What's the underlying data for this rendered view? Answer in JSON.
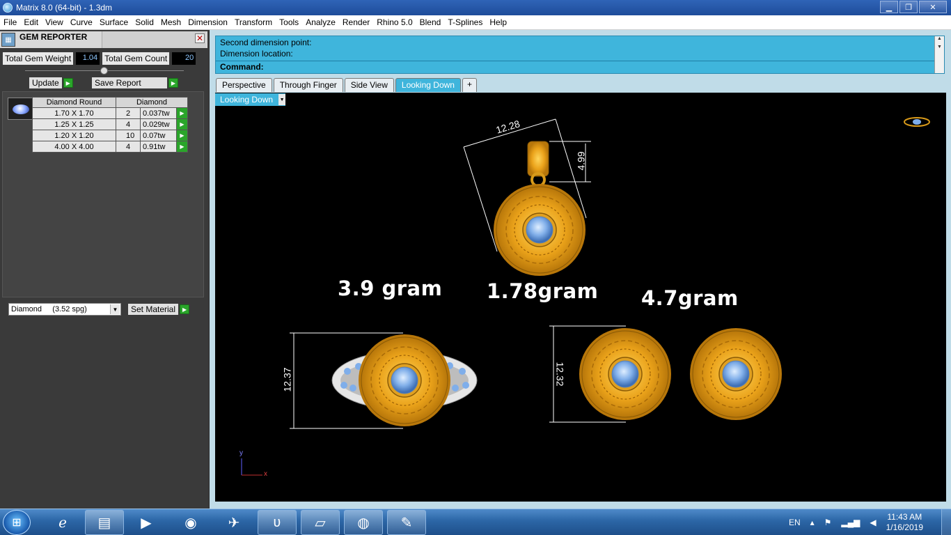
{
  "window": {
    "title": "Matrix 8.0 (64-bit) - 1.3dm",
    "minimize": "▁",
    "maximize": "❐",
    "close": "✕"
  },
  "menu": [
    "File",
    "Edit",
    "View",
    "Curve",
    "Surface",
    "Solid",
    "Mesh",
    "Dimension",
    "Transform",
    "Tools",
    "Analyze",
    "Render",
    "Rhino 5.0",
    "Blend",
    "T-Splines",
    "Help"
  ],
  "gem_reporter": {
    "title": "GEM REPORTER",
    "close": "✕",
    "total_weight_label": "Total Gem Weight",
    "total_weight_value": "1.04",
    "total_count_label": "Total Gem Count",
    "total_count_value": "20",
    "update_label": "Update",
    "save_report_label": "Save Report",
    "table": {
      "headers": [
        "Diamond Round",
        "Diamond"
      ],
      "rows": [
        {
          "size": "1.70 X 1.70",
          "qty": "2",
          "tw": "0.037tw"
        },
        {
          "size": "1.25 X 1.25",
          "qty": "4",
          "tw": "0.029tw"
        },
        {
          "size": "1.20 X 1.20",
          "qty": "10",
          "tw": "0.07tw"
        },
        {
          "size": "4.00 X 4.00",
          "qty": "4",
          "tw": "0.91tw"
        }
      ]
    },
    "material_value": "Diamond     (3.52 spg)",
    "set_material_label": "Set Material"
  },
  "command": {
    "line1": "Second dimension point:",
    "line2": "Dimension location:",
    "prompt": "Command:"
  },
  "tabs": [
    "Perspective",
    "Through Finger",
    "Side View",
    "Looking Down",
    "+"
  ],
  "active_tab": "Looking Down",
  "viewport": {
    "label": "Looking Down",
    "weights": {
      "ring": "3.9 gram",
      "pendant": "1.78gram",
      "earrings": "4.7gram"
    },
    "dims": {
      "pendant_width": "12.28",
      "pendant_bail": "4.99",
      "ring_height": "12.37",
      "earring_height": "12.32"
    },
    "axis_y": "y",
    "axis_x": "x"
  },
  "taskbar": {
    "start": "⊞",
    "apps": [
      "ie-icon",
      "explorer-icon",
      "media-player-icon",
      "chrome-icon",
      "game-icon",
      "vo-icon",
      "notes-icon",
      "globe-download-icon",
      "paint-icon"
    ],
    "lang": "EN",
    "time": "11:43 AM",
    "date": "1/16/2019"
  },
  "colors": {
    "accent": "#3fb5dc",
    "gold": "#f0b020",
    "stone": "#7faeea",
    "go_green": "#2aa52a"
  }
}
